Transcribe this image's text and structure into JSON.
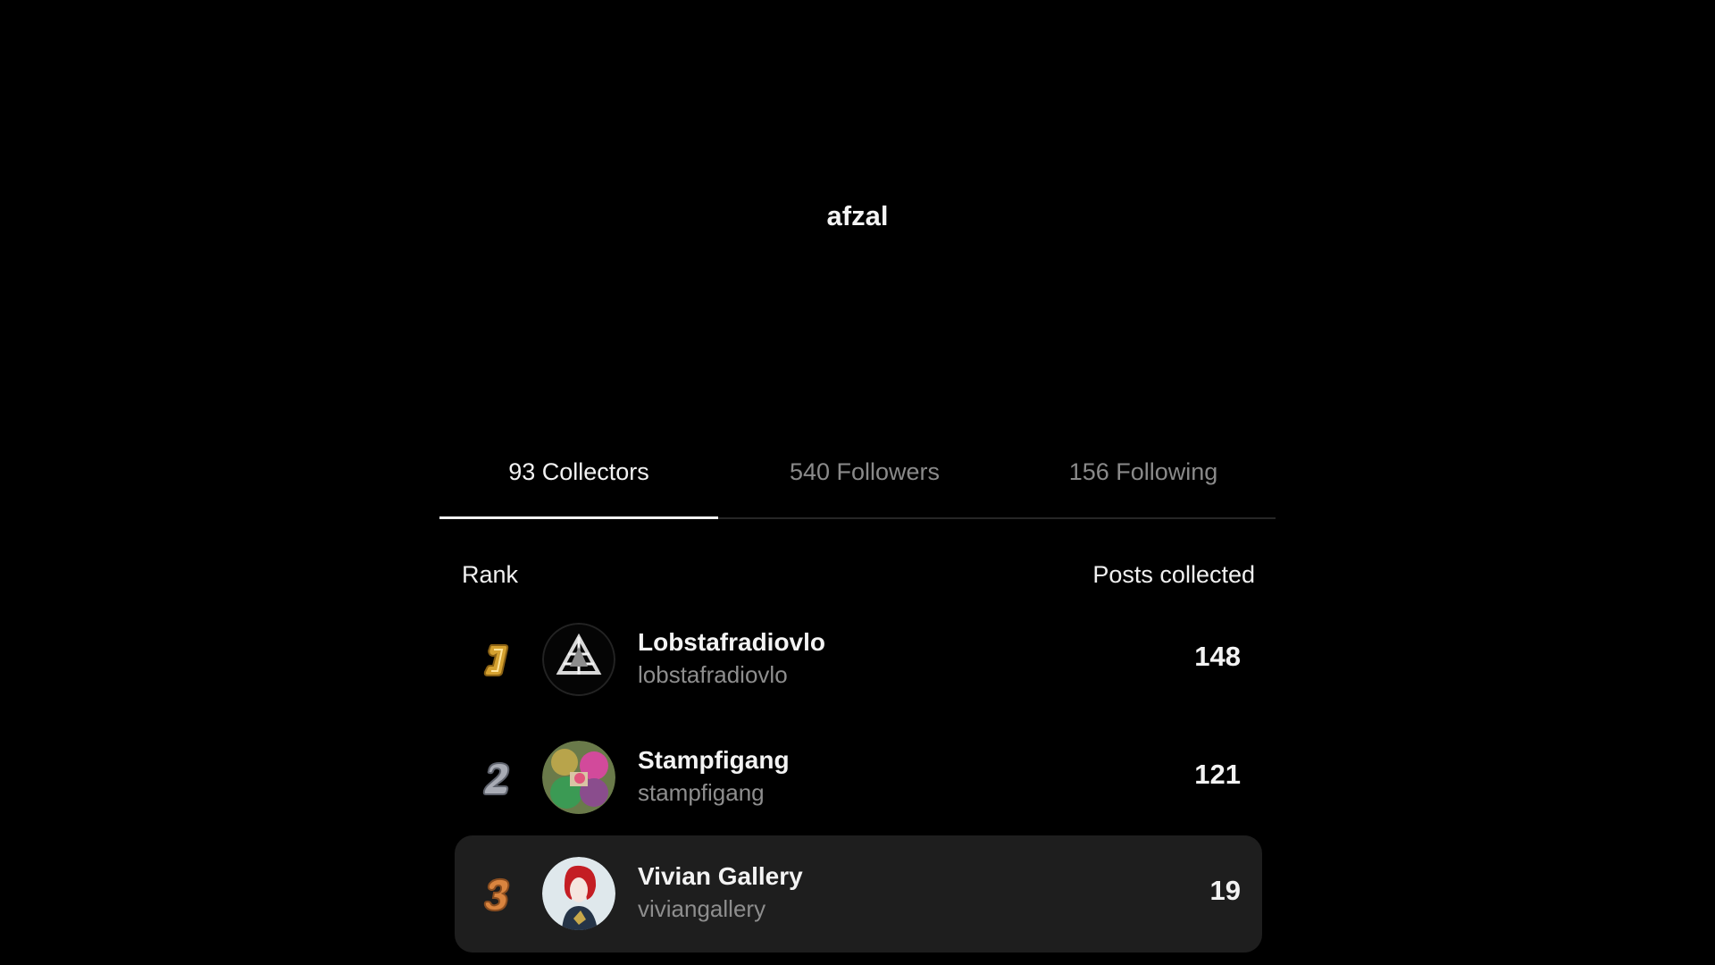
{
  "profile": {
    "title": "afzal"
  },
  "tabs": [
    {
      "label": "93 Collectors",
      "active": true
    },
    {
      "label": "540 Followers",
      "active": false
    },
    {
      "label": "156 Following",
      "active": false
    }
  ],
  "table": {
    "rank_header": "Rank",
    "posts_header": "Posts collected",
    "rows": [
      {
        "rank": "1",
        "rank_icon": "gold-rank-1-icon",
        "name": "Lobstafradiovlo",
        "handle": "lobstafradiovlo",
        "count": "148",
        "avatar": "geometric-triangle-avatar"
      },
      {
        "rank": "2",
        "rank_icon": "silver-rank-2-icon",
        "name": "Stampfigang",
        "handle": "stampfigang",
        "count": "121",
        "avatar": "colorful-abstract-avatar"
      },
      {
        "rank": "3",
        "rank_icon": "bronze-rank-3-icon",
        "name": "Vivian Gallery",
        "handle": "viviangallery",
        "count": "19",
        "avatar": "red-haired-figure-avatar",
        "highlighted": true
      }
    ]
  },
  "colors": {
    "background": "#000000",
    "row_highlight": "#1e1e1e",
    "gold": "#d9a531",
    "silver": "#a7aab3",
    "bronze": "#d7823f"
  }
}
